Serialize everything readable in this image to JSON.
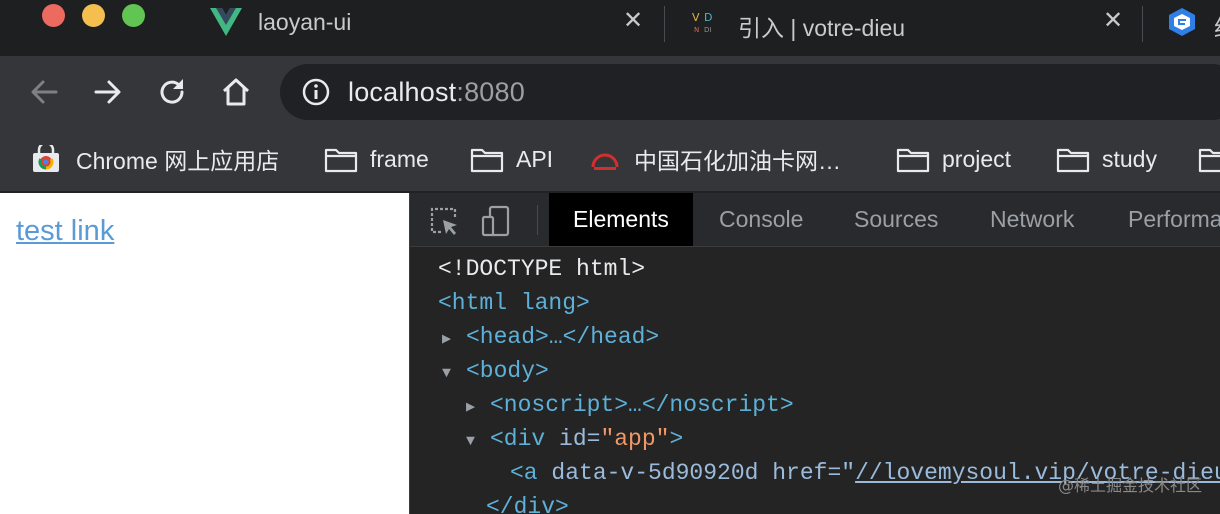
{
  "browser": {
    "tabs": [
      {
        "title": "laoyan-ui",
        "favicon": "vue-logo-icon"
      },
      {
        "title": "引入 | votre-dieu",
        "favicon": "vd-logo-icon"
      },
      {
        "title": "约",
        "favicon": "hex-logo-icon"
      }
    ],
    "address": {
      "host": "localhost",
      "port": ":8080"
    },
    "bookmarks": [
      {
        "label": "Chrome 网上应用店",
        "icon": "chrome-store-icon"
      },
      {
        "label": "frame",
        "icon": "folder-icon"
      },
      {
        "label": "API",
        "icon": "folder-icon"
      },
      {
        "label": "中国石化加油卡网…",
        "icon": "sinopec-icon"
      },
      {
        "label": "project",
        "icon": "folder-icon"
      },
      {
        "label": "study",
        "icon": "folder-icon"
      }
    ]
  },
  "page": {
    "link_text": "test link",
    "link_color": "#5b9bd5"
  },
  "devtools": {
    "tabs": [
      "Elements",
      "Console",
      "Sources",
      "Network",
      "Performa"
    ],
    "active_tab": "Elements",
    "dom": {
      "doctype": "<!DOCTYPE html>",
      "html_open": "<html lang>",
      "head": "<head>…</head>",
      "body_open": "<body>",
      "noscript": "<noscript>…</noscript>",
      "div_tag": "<div",
      "div_attr": " id=",
      "div_val": "\"app\"",
      "div_end": ">",
      "a_tag": "<a",
      "a_attr": " data-v-5d90920d href=",
      "a_quote": "\"",
      "a_href": "//lovemysoul.vip/votre-dieu",
      "div_close": "</div>"
    },
    "colors": {
      "tag": "#5db0d7",
      "attr": "#9bbbdc",
      "value": "#f29766"
    }
  },
  "watermark": "@稀土掘金技术社区"
}
